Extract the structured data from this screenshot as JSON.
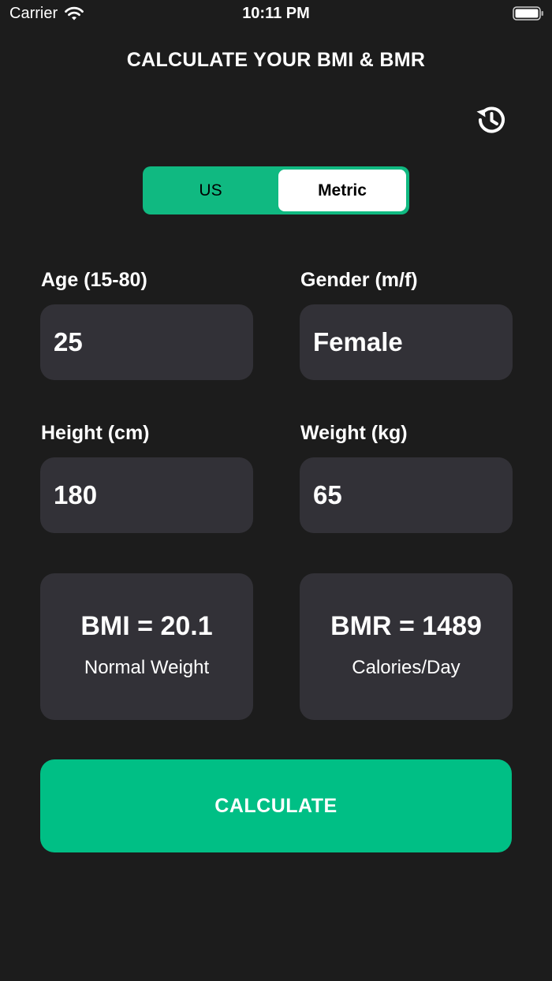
{
  "status_bar": {
    "carrier": "Carrier",
    "time": "10:11 PM"
  },
  "header": {
    "title": "CALCULATE YOUR BMI & BMR"
  },
  "units": {
    "options": [
      "US",
      "Metric"
    ],
    "selected": "Metric"
  },
  "form": {
    "age": {
      "label": "Age (15-80)",
      "value": "25"
    },
    "gender": {
      "label": "Gender (m/f)",
      "value": "Female"
    },
    "height": {
      "label": "Height (cm)",
      "value": "180"
    },
    "weight": {
      "label": "Weight (kg)",
      "value": "65"
    }
  },
  "results": {
    "bmi": {
      "value": "BMI = 20.1",
      "category": "Normal Weight"
    },
    "bmr": {
      "value": "BMR = 1489",
      "unit": "Calories/Day"
    }
  },
  "actions": {
    "calculate_label": "CALCULATE"
  },
  "colors": {
    "background": "#1c1c1c",
    "accent": "#00bf85",
    "card": "#323137"
  }
}
